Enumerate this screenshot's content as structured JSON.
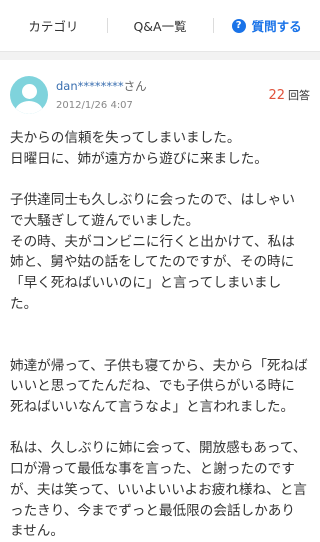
{
  "tabs": {
    "category": "カテゴリ",
    "qa_list": "Q&A一覧",
    "ask_icon": "?",
    "ask": "質問する"
  },
  "post": {
    "username": "dan********",
    "username_suffix": "さん",
    "date": "2012/1/26 4:07",
    "answer_count": "22",
    "answer_label": "回答",
    "paragraphs": [
      "夫からの信頼を失ってしまいました。",
      "日曜日に、姉が遠方から遊びに来ました。",
      "",
      "子供達同士も久しぶりに会ったので、はしゃいで大騒ぎして遊んでいました。",
      "その時、夫がコンビニに行くと出かけて、私は姉と、舅や姑の話をしてたのですが、その時に「早く死ねばいいのに」と言ってしまいました。",
      "",
      "",
      "姉達が帰って、子供も寝てから、夫から「死ねばいいと思ってたんだね、でも子供らがいる時に死ねばいいなんて言うなよ」と言われました。",
      "",
      "私は、久しぶりに姉に会って、開放感もあって、口が滑って最低な事を言った、と謝ったのですが、夫は笑って、いいよいいよお疲れ様ね、と言ったきり、今までずっと最低限の会話しかありません。"
    ]
  }
}
